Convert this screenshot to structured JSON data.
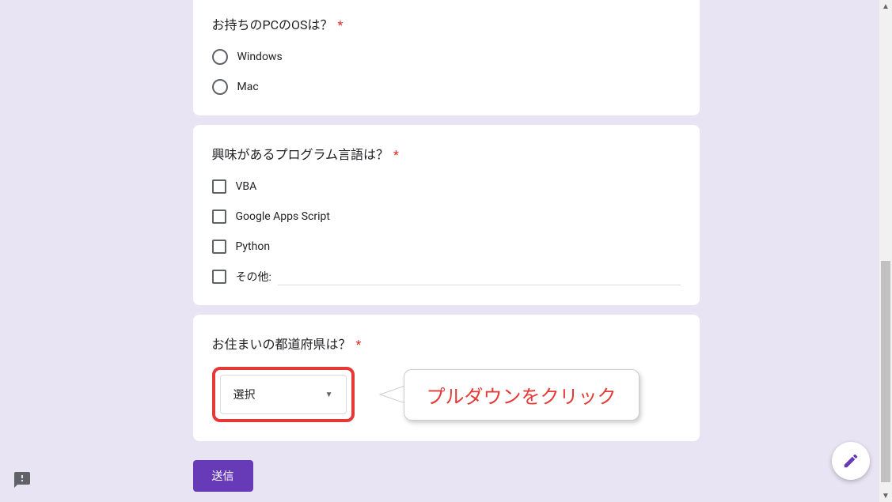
{
  "questions": {
    "os": {
      "title": "お持ちのPCのOSは？",
      "options": [
        "Windows",
        "Mac"
      ]
    },
    "language": {
      "title": "興味があるプログラム言語は？",
      "options": [
        "VBA",
        "Google Apps Script",
        "Python"
      ],
      "other_label": "その他:"
    },
    "prefecture": {
      "title": "お住まいの都道府県は？",
      "dropdown_placeholder": "選択"
    }
  },
  "required_mark": "*",
  "callout_text": "プルダウンをクリック",
  "submit_label": "送信",
  "colors": {
    "accent": "#673ab7",
    "highlight": "#e53935",
    "required": "#d93025"
  }
}
